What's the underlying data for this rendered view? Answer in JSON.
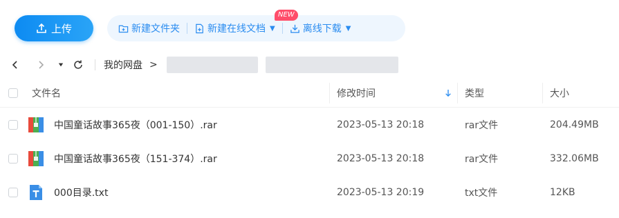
{
  "toolbar": {
    "upload_label": "上传",
    "new_folder_label": "新建文件夹",
    "new_online_doc_label": "新建在线文档",
    "new_badge": "NEW",
    "offline_download_label": "离线下载"
  },
  "nav": {
    "breadcrumb_root": "我的网盘",
    "breadcrumb_sep": ">"
  },
  "table": {
    "headers": {
      "name": "文件名",
      "modified": "修改时间",
      "type": "类型",
      "size": "大小"
    },
    "rows": [
      {
        "name": "中国童话故事365夜（001-150）.rar",
        "modified": "2023-05-13 20:18",
        "type": "rar文件",
        "size": "204.49MB",
        "icon": "rar-archive-icon"
      },
      {
        "name": "中国童话故事365夜（151-374）.rar",
        "modified": "2023-05-13 20:18",
        "type": "rar文件",
        "size": "332.06MB",
        "icon": "rar-archive-icon"
      },
      {
        "name": "000目录.txt",
        "modified": "2023-05-13 20:19",
        "type": "txt文件",
        "size": "12KB",
        "icon": "txt-file-icon"
      }
    ]
  },
  "colors": {
    "accent": "#2a8cf0",
    "upload_bg": "#0d8bf2",
    "badge": "#ff4d6a"
  }
}
